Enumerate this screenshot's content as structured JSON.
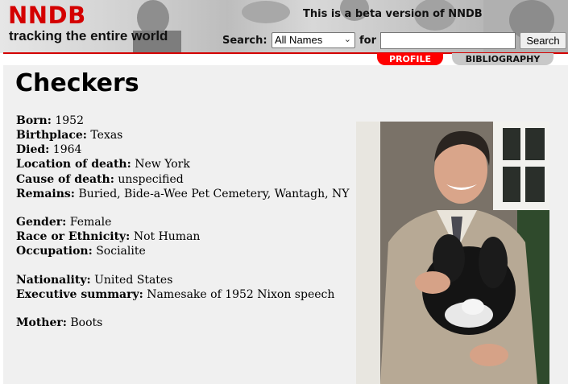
{
  "header": {
    "logo": "NNDB",
    "tagline": "tracking the entire world",
    "beta_notice": "This is a beta version of NNDB",
    "search_label": "Search:",
    "search_select_value": "All Names",
    "for_label": "for",
    "search_input_value": "",
    "search_button_label": "Search"
  },
  "tabs": {
    "profile": "PROFILE",
    "bibliography": "BIBLIOGRAPHY"
  },
  "page_title": "Checkers",
  "facts": [
    {
      "label": "Born:",
      "value": "1952"
    },
    {
      "label": "Birthplace:",
      "value": "Texas"
    },
    {
      "label": "Died:",
      "value": "1964"
    },
    {
      "label": "Location of death:",
      "value": "New York"
    },
    {
      "label": "Cause of death:",
      "value": "unspecified"
    },
    {
      "label": "Remains:",
      "value": "Buried, Bide-a-Wee Pet Cemetery, Wantagh, NY"
    },
    {
      "label": "Gender:",
      "value": "Female"
    },
    {
      "label": "Race or Ethnicity:",
      "value": "Not Human"
    },
    {
      "label": "Occupation:",
      "value": "Socialite"
    },
    {
      "label": "Nationality:",
      "value": "United States"
    },
    {
      "label": "Executive summary:",
      "value": "Namesake of 1952 Nixon speech"
    },
    {
      "label": "Mother:",
      "value": "Boots"
    }
  ],
  "colors": {
    "brand_red": "#d40000",
    "tab_active": "#ff0000",
    "tab_inactive": "#c8c8c8",
    "content_bg": "#f0f0f0"
  }
}
